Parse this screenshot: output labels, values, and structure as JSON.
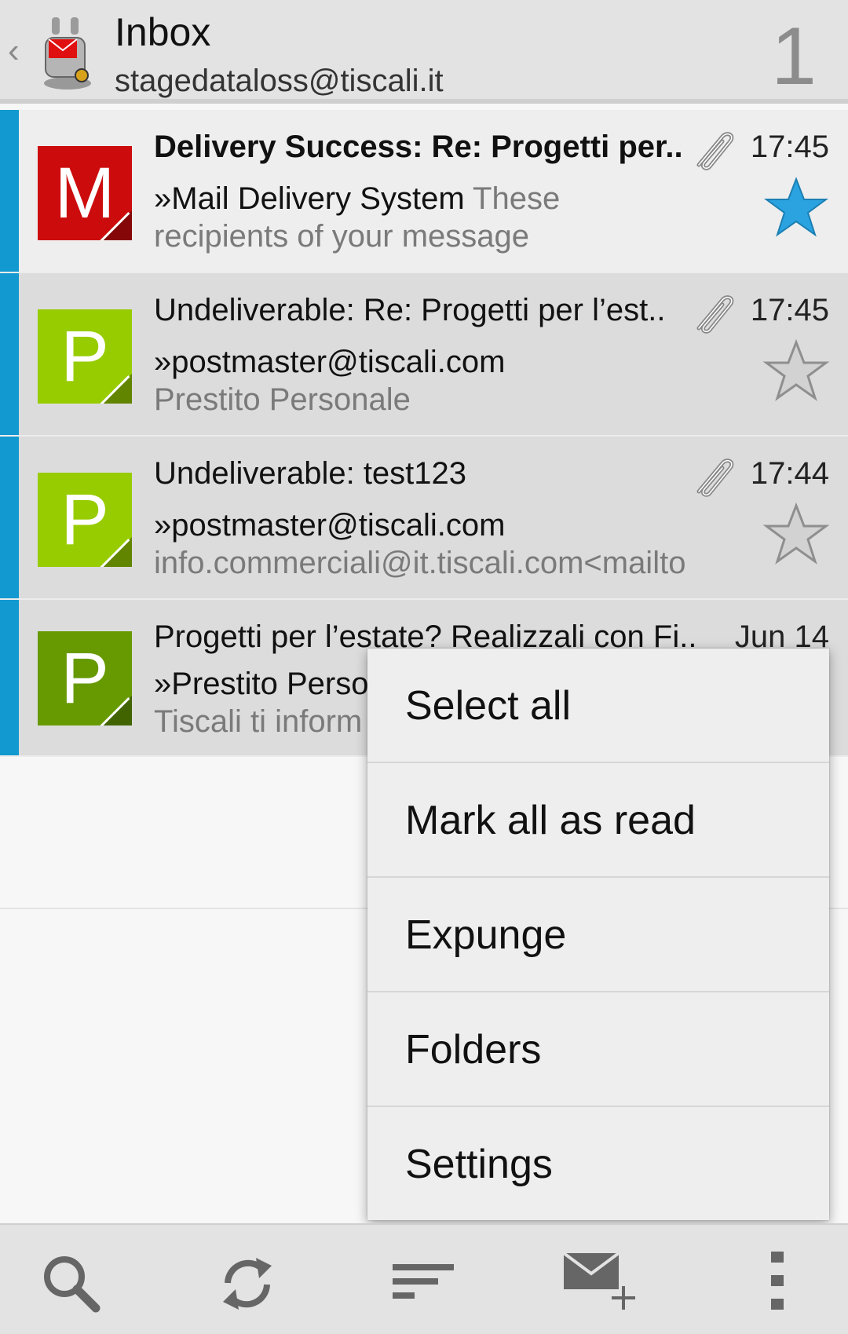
{
  "header": {
    "back_glyph": "‹",
    "title": "Inbox",
    "account": "stagedataloss@tiscali.it",
    "unread_count": "1",
    "logo_icon": "k9-mail-logo"
  },
  "messages": [
    {
      "avatar_letter": "M",
      "avatar_color": "#cc0c0c",
      "subject": "Delivery Success: Re: Progetti per..",
      "sender": "»Mail Delivery System",
      "preview_inline": " These",
      "preview_line2": "recipients of your message",
      "time": "17:45",
      "has_attachment": true,
      "starred": true,
      "unread": true
    },
    {
      "avatar_letter": "P",
      "avatar_color": "#97cc00",
      "subject": "Undeliverable: Re: Progetti per l’est..",
      "sender": "»postmaster@tiscali.com",
      "preview_inline": "",
      "preview_line2": "Prestito Personale",
      "time": "17:45",
      "has_attachment": true,
      "starred": false,
      "unread": false
    },
    {
      "avatar_letter": "P",
      "avatar_color": "#97cc00",
      "subject": "Undeliverable: test123",
      "sender": "»postmaster@tiscali.com",
      "preview_inline": "",
      "preview_line2": "info.commerciali@it.tiscali.com<mailto",
      "time": "17:44",
      "has_attachment": true,
      "starred": false,
      "unread": false
    },
    {
      "avatar_letter": "P",
      "avatar_color": "#669a00",
      "subject": "Progetti per l’estate? Realizzali con Fi..",
      "sender": "»Prestito Perso",
      "preview_inline": "",
      "preview_line2": "Tiscali ti inform",
      "time": "Jun 14",
      "has_attachment": false,
      "starred": false,
      "unread": false
    }
  ],
  "menu": {
    "items": [
      "Select all",
      "Mark all as read",
      "Expunge",
      "Folders",
      "Settings"
    ]
  },
  "bottom_bar": {
    "icons": [
      "search-icon",
      "refresh-icon",
      "sort-icon",
      "compose-icon",
      "overflow-menu-icon"
    ]
  },
  "colors": {
    "accent": "#1299cf",
    "star_active": "#2aa3e0",
    "star_inactive": "#9a9a9a"
  }
}
